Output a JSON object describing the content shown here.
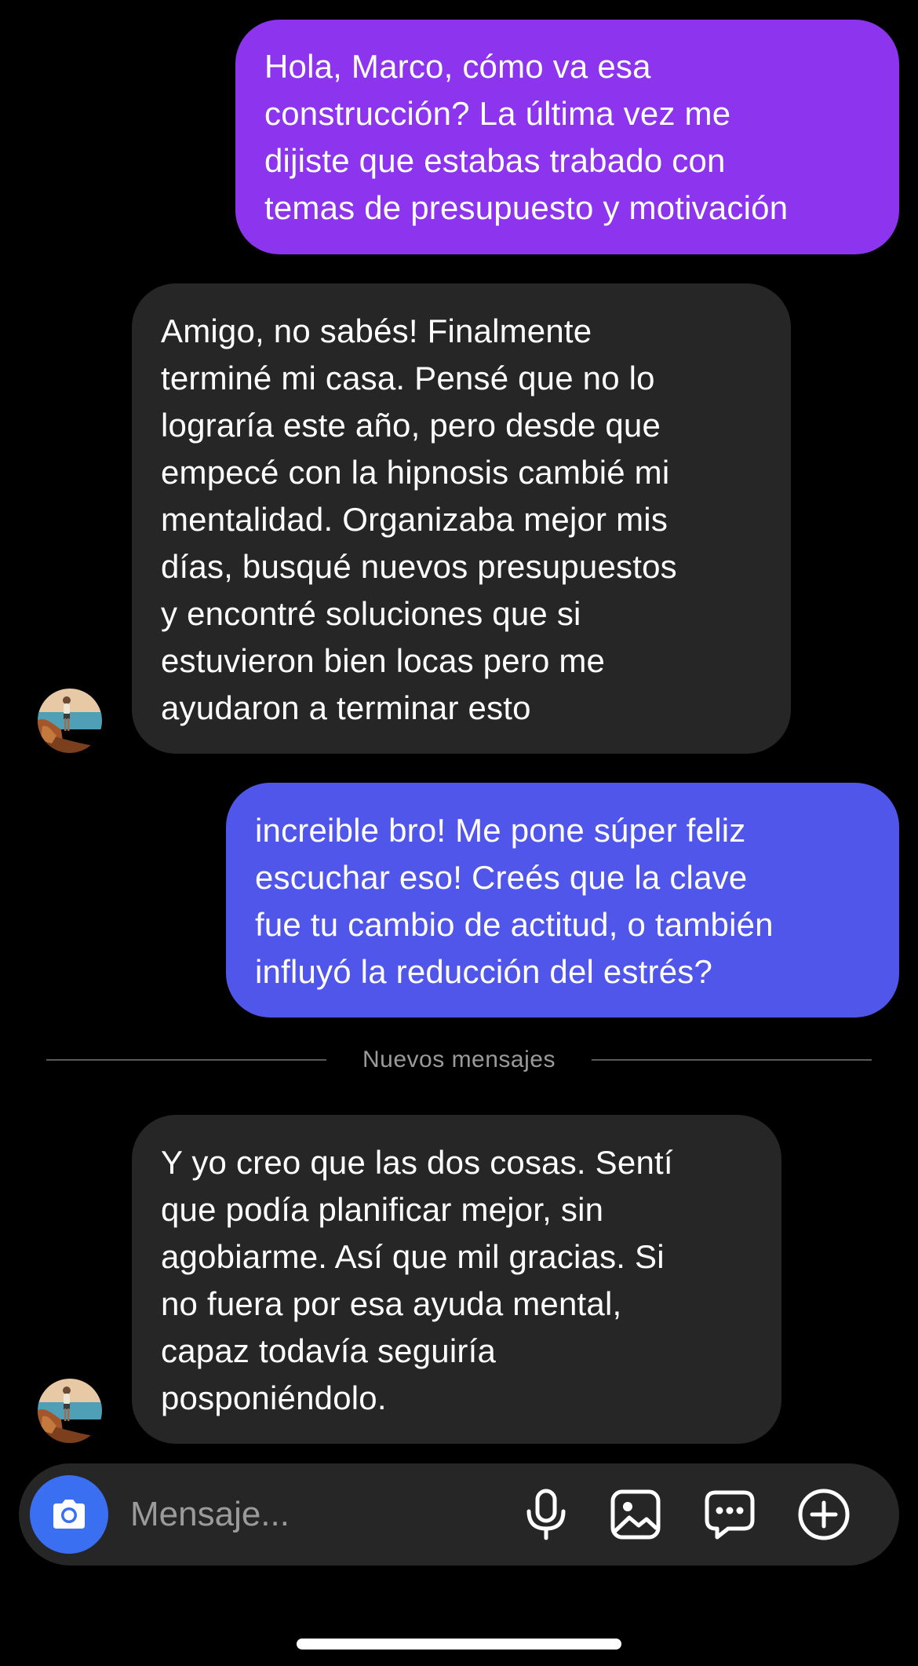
{
  "conversation": {
    "messages": [
      {
        "direction": "outgoing",
        "text": "Hola, Marco, cómo va esa\nconstrucción? La última vez me\ndijiste que estabas trabado con\ntemas de presupuesto y motivación",
        "bubble_color": "#8c34ee"
      },
      {
        "direction": "incoming",
        "text": "Amigo, no sabés! Finalmente\nterminé mi casa. Pensé que no lo\nlograría este año, pero desde que\nempecé con la hipnosis cambié mi\nmentalidad. Organizaba mejor mis\ndías, busqué nuevos presupuestos\ny encontré soluciones que si\nestuvieron bien locas pero me\nayudaron a terminar esto",
        "bubble_color": "#262626"
      },
      {
        "direction": "outgoing",
        "text": "increible bro! Me pone súper feliz\nescuchar eso! Creés que la clave\nfue tu cambio de actitud, o también\ninfluyó la reducción del estrés?",
        "bubble_color": "#5156ea"
      },
      {
        "direction": "incoming",
        "text": "Y yo creo que las dos cosas. Sentí\nque podía planificar mejor, sin\nagobiarme. Así que mil gracias. Si\nno fuera por esa ayuda mental,\ncapaz todavía seguiría\nposponiéndolo.",
        "bubble_color": "#262626"
      }
    ],
    "new_messages_divider": "Nuevos mensajes"
  },
  "composer": {
    "placeholder": "Mensaje...",
    "icons": [
      "camera-icon",
      "microphone-icon",
      "gallery-icon",
      "sticker-icon",
      "plus-icon"
    ],
    "camera_button_color": "#3a6ff2"
  },
  "theme": {
    "background": "#000000",
    "incoming_bubble": "#262626",
    "text": "#ffffff",
    "muted_text": "#9a9a9a"
  }
}
